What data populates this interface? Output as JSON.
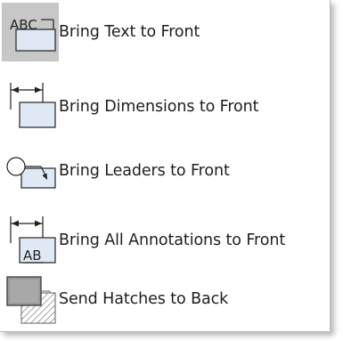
{
  "menu": {
    "items": [
      {
        "label": "Bring Text to Front",
        "icon": "bring-text-to-front-icon",
        "highlighted": true
      },
      {
        "label": "Bring Dimensions to Front",
        "icon": "bring-dimensions-to-front-icon",
        "highlighted": false
      },
      {
        "label": "Bring Leaders to Front",
        "icon": "bring-leaders-to-front-icon",
        "highlighted": false
      },
      {
        "label": "Bring All Annotations to Front",
        "icon": "bring-all-annotations-to-front-icon",
        "highlighted": false
      },
      {
        "label": "Send Hatches to Back",
        "icon": "send-hatches-to-back-icon",
        "highlighted": false
      }
    ],
    "icon_text": {
      "abc": "ABC",
      "ab": "AB"
    },
    "colors": {
      "highlight": "#c7c7c7",
      "icon_blue": "#dfe9f5",
      "icon_stroke": "#222222",
      "hatch_gray": "#9a9a9a"
    }
  }
}
